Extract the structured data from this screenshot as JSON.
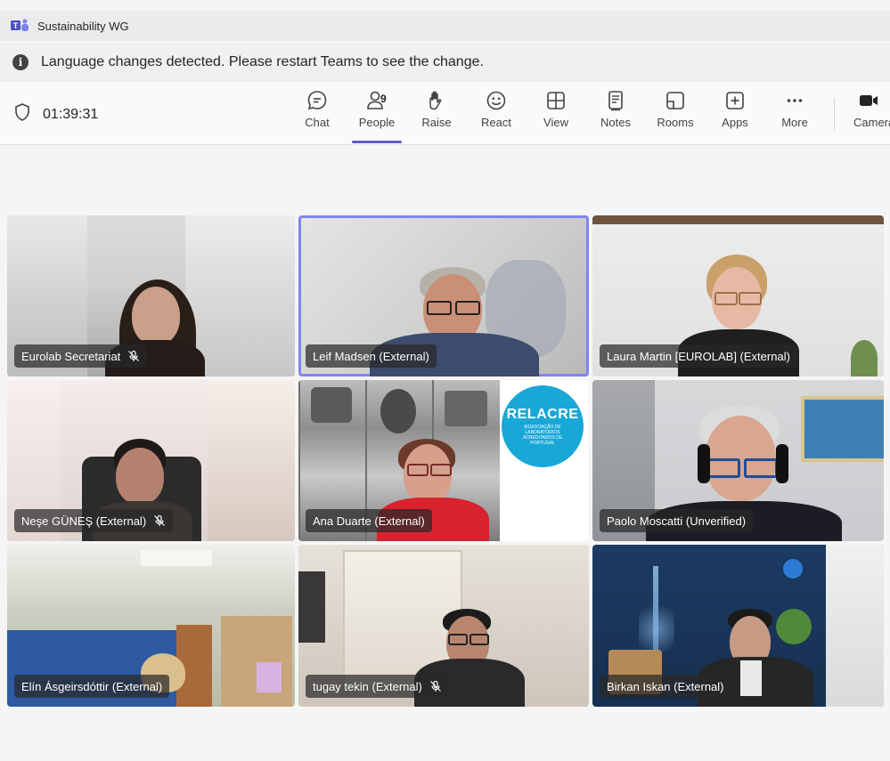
{
  "window": {
    "title": "Sustainability WG"
  },
  "notice": {
    "message": "Language changes detected. Please restart Teams to see the change."
  },
  "meeting": {
    "elapsed": "01:39:31"
  },
  "toolbar": {
    "buttons": [
      {
        "label": "Chat",
        "icon": "chat-icon"
      },
      {
        "label": "People",
        "icon": "people-icon",
        "count": "9",
        "active": true
      },
      {
        "label": "Raise",
        "icon": "raise-hand-icon"
      },
      {
        "label": "React",
        "icon": "smile-icon"
      },
      {
        "label": "View",
        "icon": "grid-icon"
      },
      {
        "label": "Notes",
        "icon": "notes-icon"
      },
      {
        "label": "Rooms",
        "icon": "rooms-icon"
      },
      {
        "label": "Apps",
        "icon": "plus-square-icon"
      },
      {
        "label": "More",
        "icon": "more-icon"
      },
      {
        "label": "Camera",
        "icon": "camera-icon"
      }
    ]
  },
  "participants": [
    {
      "name": "Eurolab Secretariat",
      "muted": true
    },
    {
      "name": "Leif Madsen (External)",
      "muted": false,
      "speaking": true
    },
    {
      "name": "Laura Martin [EUROLAB] (External)",
      "muted": false
    },
    {
      "name": "Neşe GÜNEŞ (External)",
      "muted": true
    },
    {
      "name": "Ana Duarte (External)",
      "muted": false
    },
    {
      "name": "Paolo Moscatti (Unverified)",
      "muted": false
    },
    {
      "name": "Elín Ásgeirsdóttir (External)",
      "muted": false
    },
    {
      "name": "tugay tekin (External)",
      "muted": true
    },
    {
      "name": "Birkan Iskan (External)",
      "muted": false
    }
  ],
  "relacre_logo": {
    "text": "RELACRE",
    "subtext": "ASSOCIAÇÃO DE LABORATÓRIOS ACREDITADOS DE PORTUGAL"
  },
  "colors": {
    "accent": "#5b5fc7",
    "speaking_border": "#7f85f5",
    "nameplate_bg": "#282828"
  }
}
